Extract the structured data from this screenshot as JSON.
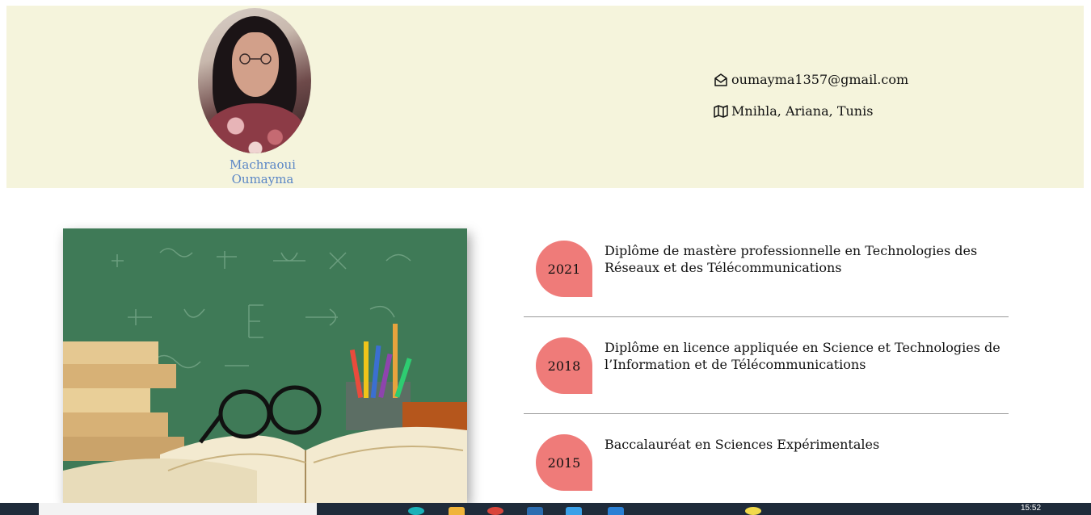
{
  "profile": {
    "name": "Machraoui Oumayma",
    "email": "oumayma1357@gmail.com",
    "location": "Mnihla, Ariana, Tunis"
  },
  "icons": {
    "email": "envelope-open-icon",
    "location": "map-icon"
  },
  "education": [
    {
      "year": "2021",
      "title": "Diplôme de mastère professionnelle en Technologies des Réseaux et des Télécommunications"
    },
    {
      "year": "2018",
      "title": "Diplôme en licence appliquée en Science et Technologies de l’Information et de Télécommunications"
    },
    {
      "year": "2015",
      "title": "Baccalauréat en Sciences Expérimentales"
    }
  ],
  "taskbar": {
    "time": "15:52"
  },
  "colors": {
    "header_bg": "#f5f4dc",
    "name_color": "#5a86c6",
    "year_bubble": "#ef7b79",
    "chalkboard": "#3f7a57"
  }
}
